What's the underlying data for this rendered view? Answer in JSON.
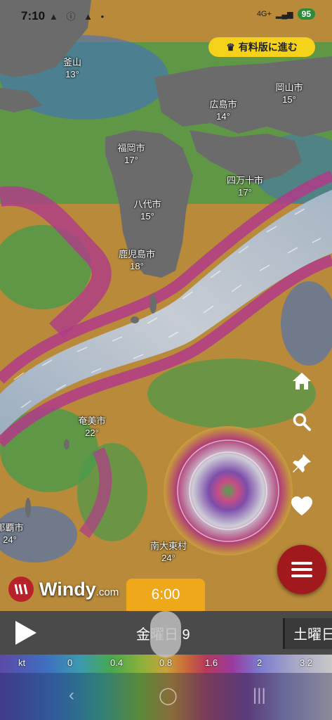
{
  "status_bar": {
    "time": "7:10",
    "left_icons": "▲ ⓘ ▲ •",
    "signal": "4G+",
    "battery": "95"
  },
  "premium_button": {
    "label": "有料版に進む",
    "icon": "crown-icon"
  },
  "cities": [
    {
      "name": "釜山",
      "temp": "13°"
    },
    {
      "name": "岡山市",
      "temp": "15°"
    },
    {
      "name": "広島市",
      "temp": "14°"
    },
    {
      "name": "福岡市",
      "temp": "17°"
    },
    {
      "name": "四万十市",
      "temp": "17°"
    },
    {
      "name": "八代市",
      "temp": "15°"
    },
    {
      "name": "鹿児島市",
      "temp": "18°"
    },
    {
      "name": "奄美市",
      "temp": "22°"
    },
    {
      "name": "那覇市",
      "temp": "24°"
    },
    {
      "name": "南大東村",
      "temp": "24°"
    }
  ],
  "right_toolbar": {
    "home": "home-icon",
    "search": "search-icon",
    "pin": "pin-icon",
    "favorite": "heart-icon",
    "menu": "menu-icon"
  },
  "logo": {
    "name": "Windy",
    "suffix": ".com"
  },
  "timeline": {
    "current_time": "6:00",
    "day_label": "金曜日 9",
    "next_day": "土曜日"
  },
  "legend": {
    "unit": "kt",
    "values": [
      "0",
      "0.4",
      "0.8",
      "1.6",
      "2",
      "3.2"
    ]
  },
  "colors": {
    "premium": "#f5d21a",
    "menu_button": "#a1191d",
    "time_bubble": "#f0a81b",
    "logo_red": "#b8202a"
  }
}
